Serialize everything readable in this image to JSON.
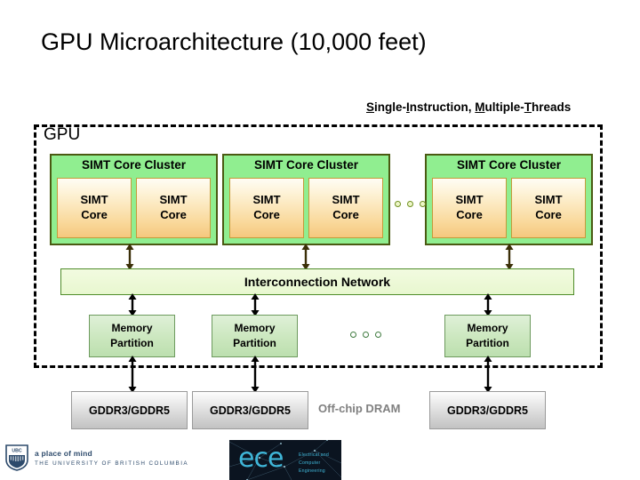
{
  "slide": {
    "title": "GPU Microarchitecture (10,000 feet)",
    "annotation": {
      "prefix_s": "S",
      "seg1": "ingle-",
      "prefix_i": "I",
      "seg2": "nstruction, ",
      "prefix_m": "M",
      "seg3": "ultiple-",
      "prefix_t": "T",
      "seg4": "hreads",
      "full_text": "Single-Instruction, Multiple-Threads"
    }
  },
  "gpu": {
    "label": "GPU",
    "clusters": [
      {
        "title": "SIMT Core Cluster",
        "cores": [
          {
            "line1": "SIMT",
            "line2": "Core"
          },
          {
            "line1": "SIMT",
            "line2": "Core"
          }
        ]
      },
      {
        "title": "SIMT Core Cluster",
        "cores": [
          {
            "line1": "SIMT",
            "line2": "Core"
          },
          {
            "line1": "SIMT",
            "line2": "Core"
          }
        ]
      },
      {
        "title": "SIMT Core Cluster",
        "cores": [
          {
            "line1": "SIMT",
            "line2": "Core"
          },
          {
            "line1": "SIMT",
            "line2": "Core"
          }
        ]
      }
    ],
    "interconnect": "Interconnection Network",
    "memory_partitions": [
      {
        "line1": "Memory",
        "line2": "Partition"
      },
      {
        "line1": "Memory",
        "line2": "Partition"
      },
      {
        "line1": "Memory",
        "line2": "Partition"
      }
    ]
  },
  "dram": {
    "label": "Off-chip DRAM",
    "modules": [
      {
        "label": "GDDR3/GDDR5"
      },
      {
        "label": "GDDR3/GDDR5"
      },
      {
        "label": "GDDR3/GDDR5"
      }
    ]
  },
  "footer": {
    "ubc": {
      "tagline": "a place of mind",
      "university": "THE UNIVERSITY OF BRITISH COLUMBIA",
      "crest_text": "UBC"
    },
    "ece": {
      "word": "ece",
      "sub_line1": "Electrical and",
      "sub_line2": "Computer",
      "sub_line3": "Engineering"
    }
  },
  "colors": {
    "cluster_fill": "#90ee90",
    "cluster_border": "#4a5a12",
    "core_fill_top": "#fffdf4",
    "core_fill_bottom": "#f5c87e",
    "core_border": "#c49a3a",
    "interconnect_fill": "#e8f7cf",
    "interconnect_border": "#4f8c2a",
    "mem_fill": "#cbe7be",
    "mem_border": "#6d9a5e",
    "gddr_fill": "#d2d2d2",
    "gddr_border": "#9a9a9a",
    "offchip_text": "#808080",
    "ubc_blue": "#2d4a6b",
    "ece_cyan": "#3fb6d8",
    "ece_bg": "#0b1420"
  }
}
